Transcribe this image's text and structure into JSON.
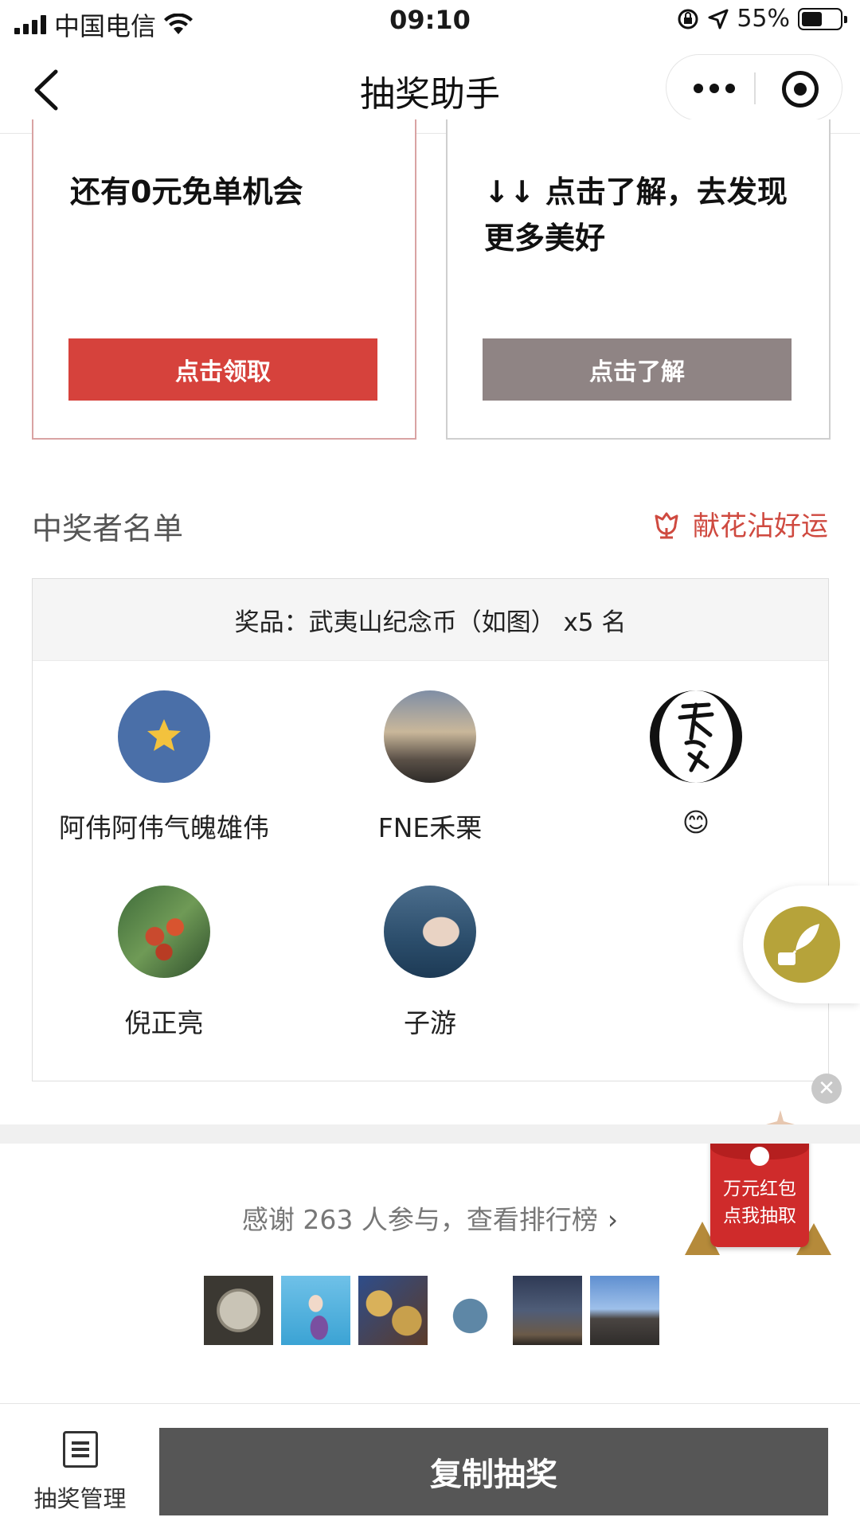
{
  "status_bar": {
    "carrier": "中国电信",
    "time": "09:10",
    "battery_percent": "55%",
    "battery_level": 0.55
  },
  "nav": {
    "title": "抽奖助手"
  },
  "cards": [
    {
      "text": "还有0元免单机会",
      "button": "点击领取",
      "accent_color": "#d6423c"
    },
    {
      "text": "↓↓ 点击了解，去发现更多美好",
      "button": "点击了解",
      "accent_color": "#8f8484"
    }
  ],
  "winners": {
    "heading": "中奖者名单",
    "flower_link": "献花沾好运",
    "prize_line": "奖品：武夷山纪念币（如图） x5 名",
    "list": [
      {
        "name": "阿伟阿伟气魄雄伟"
      },
      {
        "name": "FNE禾栗"
      },
      {
        "name": "😊"
      },
      {
        "name": "倪正亮"
      },
      {
        "name": "子游"
      }
    ]
  },
  "red_packet": {
    "line1": "万元红包",
    "line2": "点我抽取"
  },
  "participants": {
    "text": "感谢 263 人参与，查看排行榜",
    "count": 263
  },
  "bottom_bar": {
    "manage_label": "抽奖管理",
    "primary_button": "复制抽奖"
  },
  "colors": {
    "brand_red": "#d6423c",
    "link_red": "#cf4a40",
    "dark_button": "#565656"
  }
}
